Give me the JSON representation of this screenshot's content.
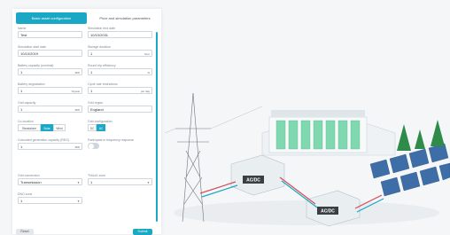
{
  "tabs": [
    {
      "label": "Basic asset configuration",
      "active": true
    },
    {
      "label": "Price and simulation parameters",
      "active": false
    }
  ],
  "fields": {
    "name": {
      "label": "Name",
      "value": "Test"
    },
    "sim_start": {
      "label": "Simulation start date",
      "value": "10/10/2019"
    },
    "sim_end": {
      "label": "Simulation end date",
      "value": "10/10/2031"
    },
    "storage_duration": {
      "label": "Storage duration",
      "value": "1",
      "unit": "hour"
    },
    "battery_capacity": {
      "label": "Battery capacity (nominal)",
      "value": "1",
      "unit": "MW"
    },
    "round_trip": {
      "label": "Round trip efficiency",
      "value": "1",
      "unit": "%"
    },
    "degradation": {
      "label": "Battery degradation",
      "value": "1",
      "unit": "%/year"
    },
    "cycle_rate": {
      "label": "Cycle rate restrictions",
      "value": "1",
      "unit": "per day"
    },
    "grid_capacity": {
      "label": "Grid capacity",
      "value": "1",
      "unit": "MW"
    },
    "grid_region": {
      "label": "Grid region",
      "value": "England"
    },
    "co_location": {
      "label": "Co-location",
      "options": [
        "Standalone",
        "Solar",
        "Wind"
      ],
      "selected": "Solar"
    },
    "grid_configuration": {
      "label": "Grid configuration",
      "options": [
        "DC",
        "AC"
      ],
      "selected": "AC"
    },
    "colocated_capacity": {
      "label": "Colocated generation capacity (REG)",
      "value": "1",
      "unit": "MW"
    },
    "frequency_response": {
      "label": "Participate in frequency response"
    },
    "grid_connection": {
      "label": "Grid connection",
      "value": "Transmission"
    },
    "tnuos_zone": {
      "label": "TNUoS zone",
      "value": "1"
    },
    "dno_zone": {
      "label": "DNO zone",
      "value": "1"
    }
  },
  "buttons": {
    "reset": "Reset",
    "run": "Submit"
  },
  "scene": {
    "converter_label_1": "AC/DC",
    "converter_label_2": "AC/DC"
  },
  "colors": {
    "accent": "#1aa8c4",
    "battery_green": "#7fd8b0",
    "cable_red": "#d94b5a",
    "tree_green": "#2e8b4a"
  }
}
